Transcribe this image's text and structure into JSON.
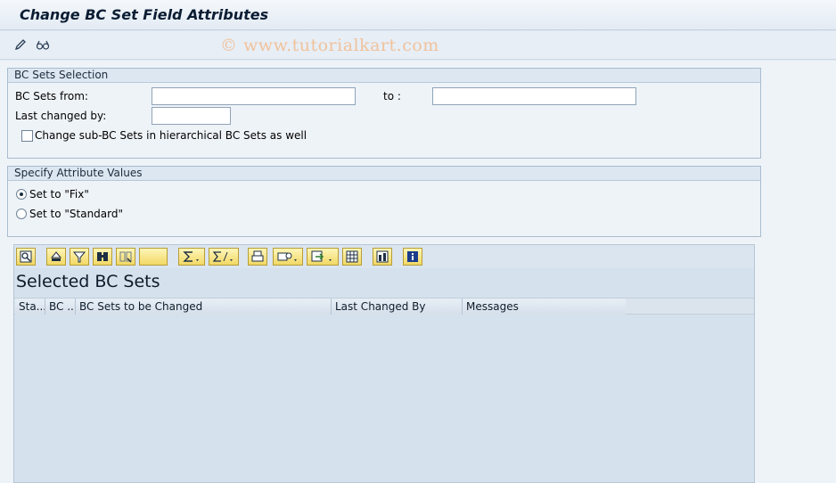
{
  "window": {
    "title": "Change BC Set Field Attributes"
  },
  "app_toolbar": {
    "icons": [
      "pencil-icon",
      "glasses-icon"
    ],
    "watermark": "© www.tutorialkart.com"
  },
  "selection_group": {
    "header": "BC Sets Selection",
    "bc_sets_from_label": "BC Sets from:",
    "bc_sets_from_value": "",
    "to_label": "to :",
    "to_value": "",
    "last_changed_label": "Last changed by:",
    "last_changed_value": "",
    "subsets_checkbox_label": "Change sub-BC Sets in hierarchical BC Sets as well",
    "subsets_checked": false
  },
  "attribute_group": {
    "header": "Specify Attribute Values",
    "option_fix": "Set to \"Fix\"",
    "option_standard": "Set to \"Standard\"",
    "selected": "fix"
  },
  "alv": {
    "title": "Selected BC Sets",
    "toolbar_icons": [
      "details-icon",
      "sort-ascending-icon",
      "filter-icon",
      "find-icon",
      "find-next-icon",
      "blank-button",
      "sum-icon",
      "subtotal-icon",
      "print-icon",
      "views-icon",
      "export-icon",
      "layout-icon",
      "abc-analysis-icon",
      "information-icon"
    ],
    "columns": [
      "Sta...",
      "BC ...",
      "BC Sets to be Changed",
      "Last Changed By",
      "Messages"
    ],
    "rows": []
  }
}
